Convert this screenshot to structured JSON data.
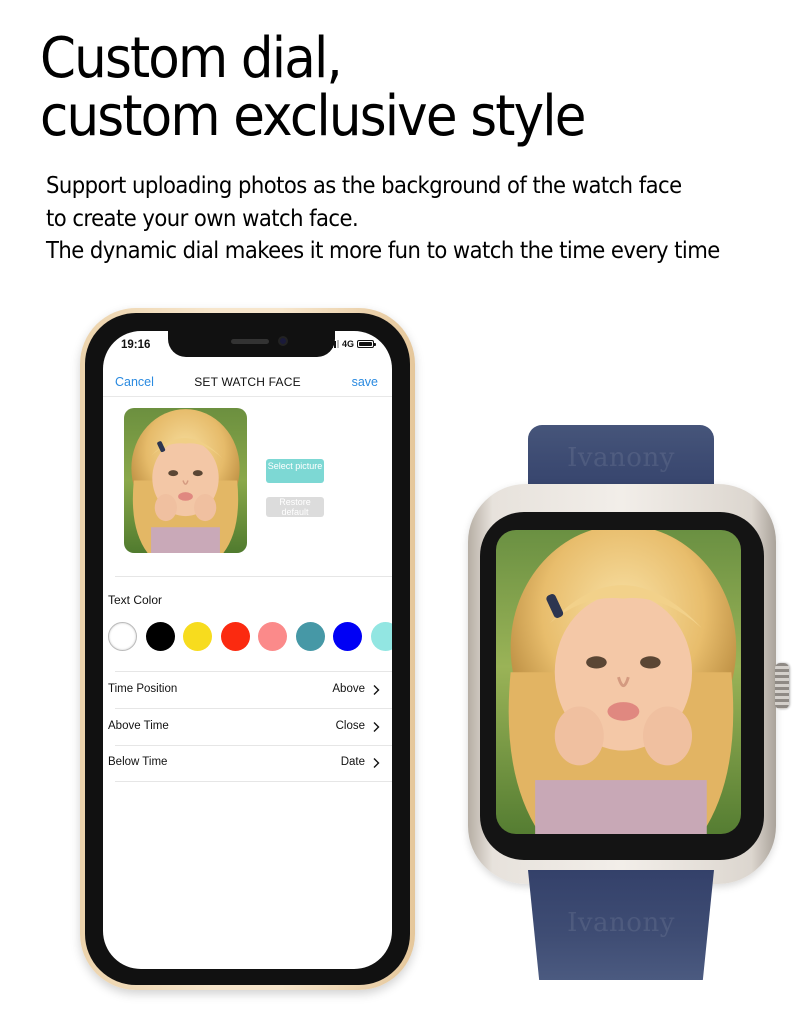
{
  "headline": {
    "lines": [
      "Custom dial,",
      "custom exclusive style"
    ]
  },
  "subtext": {
    "lines": [
      "Support uploading photos as the background of the watch face",
      "to create your own watch face.",
      "The dynamic dial makees it more fun to watch the time every time"
    ]
  },
  "phone": {
    "status_bar": {
      "time": "19:16",
      "network": "4G",
      "signal_icon": "cellular-signal-icon",
      "battery_icon": "battery-icon"
    },
    "nav": {
      "cancel_label": "Cancel",
      "title": "SET WATCH FACE",
      "save_label": "save"
    },
    "preview": {
      "image_description": "photo of blonde little girl with hands on cheeks",
      "select_picture_label": "Select picture",
      "restore_default_label": "Restore default"
    },
    "text_color": {
      "label": "Text Color",
      "swatches": [
        {
          "name": "white",
          "hex": "#ffffff"
        },
        {
          "name": "black",
          "hex": "#000000"
        },
        {
          "name": "yellow",
          "hex": "#f7dc1e"
        },
        {
          "name": "red",
          "hex": "#fb2a10"
        },
        {
          "name": "pink",
          "hex": "#fb8a8a"
        },
        {
          "name": "teal",
          "hex": "#4698a6"
        },
        {
          "name": "blue",
          "hex": "#0000f5"
        },
        {
          "name": "aqua",
          "hex": "#92e6e2"
        }
      ]
    },
    "settings": [
      {
        "label": "Time Position",
        "value": "Above"
      },
      {
        "label": "Above Time",
        "value": "Close"
      },
      {
        "label": "Below Time",
        "value": "Date"
      }
    ]
  },
  "watch": {
    "band_brand": "Ivanony",
    "screen_image_description": "photo of blonde little girl with hands on cheeks"
  },
  "colors": {
    "link_blue": "#2a8ae0",
    "select_button": "#7dd8d4",
    "restore_button": "#dcdcdc",
    "band_navy": "#3a4870",
    "phone_gold": "#f7e6cc"
  }
}
